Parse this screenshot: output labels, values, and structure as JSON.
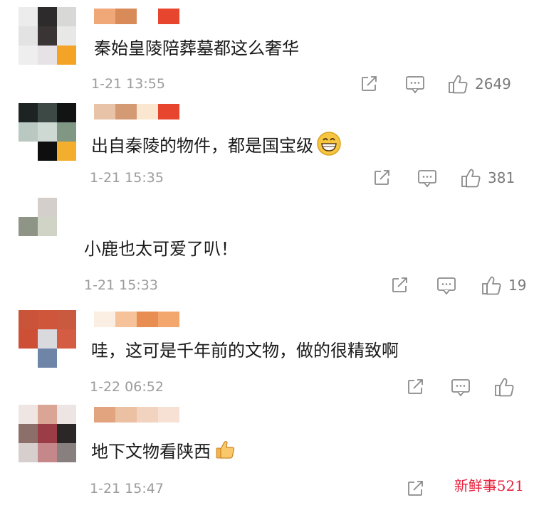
{
  "comments": [
    {
      "text": "秦始皇陵陪葬墓都这么奢华",
      "time": "1-21 13:55",
      "likes": "2649",
      "emoji": "",
      "avatar_colors": [
        "#ececec",
        "#2e2b2c",
        "#d8d8d6",
        "#e3e3e3",
        "#3a3434",
        "#e8e8e6",
        "#eeeeee",
        "#e6e2e6",
        "#f3a427"
      ],
      "name_colors": [
        "#f0a878",
        "#d98a59",
        "#ffffff",
        "#e8452e"
      ]
    },
    {
      "text": "出自秦陵的物件，都是国宝级",
      "time": "1-21 15:35",
      "likes": "381",
      "emoji": "grin-emoji",
      "avatar_colors": [
        "#1d2322",
        "#3d4944",
        "#111413",
        "#b9c8c1",
        "#cfd9d4",
        "#7f9783",
        "#ffffff",
        "#0e0e0e",
        "#f2ae2c"
      ],
      "name_colors": [
        "#e8c3a8",
        "#d49a74",
        "#fbe6cf",
        "#e8452e"
      ]
    },
    {
      "text": "小鹿也太可爱了叭！",
      "time": "1-21 15:33",
      "likes": "19",
      "emoji": "",
      "avatar_colors": [
        "#ffffff",
        "#d5cfcb",
        "#ffffff",
        "#8e9486",
        "#d0d4c6",
        "#ffffff",
        "#ffffff",
        "#ffffff",
        "#ffffff"
      ],
      "name_colors": []
    },
    {
      "text": "哇，这可是千年前的文物，做的很精致啊",
      "time": "1-22 06:52",
      "likes": "",
      "emoji": "",
      "avatar_colors": [
        "#c9543a",
        "#cf553b",
        "#c95a40",
        "#cc4f36",
        "#d9d9de",
        "#d35c42",
        "#ffffff",
        "#6f85a8",
        "#ffffff"
      ],
      "name_colors": [
        "#fbeee2",
        "#f5c29a",
        "#e98e53",
        "#f4a76d"
      ]
    },
    {
      "text": "地下文物看陕西",
      "time": "1-21 15:47",
      "likes": "",
      "emoji": "thumbs-up-emoji",
      "avatar_colors": [
        "#efe6e4",
        "#dba596",
        "#ede5e3",
        "#8c6f68",
        "#9c3c47",
        "#2b2726",
        "#d7cfcd",
        "#c6878a",
        "#88807f"
      ],
      "name_colors": [
        "#e2a47f",
        "#ecc0a2",
        "#f1d3bf",
        "#f6e1d4"
      ]
    }
  ],
  "watermark": "新鲜事521"
}
